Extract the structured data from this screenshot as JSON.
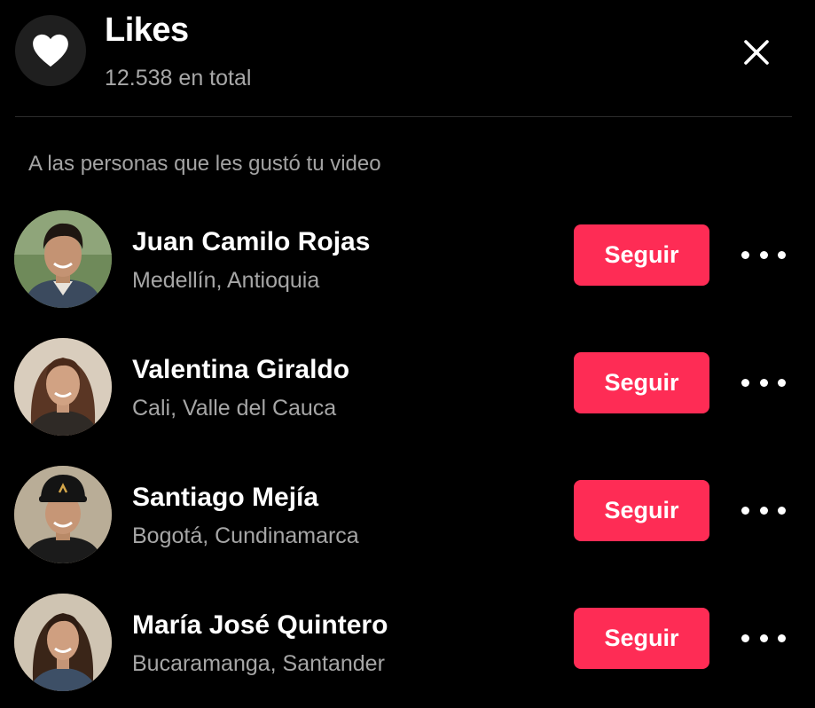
{
  "header": {
    "title": "Likes",
    "total": "12.538 en total",
    "icon": "heart-icon",
    "close_icon": "close-icon"
  },
  "section_label": "A las personas que les gustó tu video",
  "follow_label": "Seguir",
  "more_icon": "more-horizontal-icon",
  "users": [
    {
      "name": "Juan Camilo Rojas",
      "location": "Medellín, Antioquia"
    },
    {
      "name": "Valentina Giraldo",
      "location": "Cali, Valle del Cauca"
    },
    {
      "name": "Santiago Mejía",
      "location": "Bogotá, Cundinamarca"
    },
    {
      "name": "María José Quintero",
      "location": "Bucaramanga, Santander"
    }
  ],
  "colors": {
    "background": "#000000",
    "accent": "#fe2c55",
    "muted_text": "#a6a6a6",
    "icon_circle": "#1f1f1f"
  }
}
